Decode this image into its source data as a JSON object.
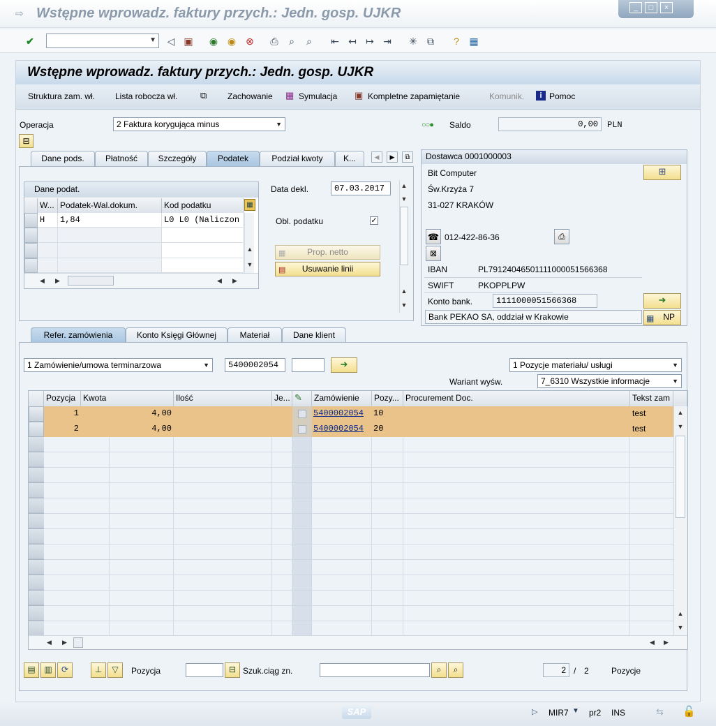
{
  "window": {
    "title": "Wstępne wprowadz. faktury przych.: Jedn. gosp. UJKR",
    "controls": [
      "minimize-icon",
      "maximize-icon",
      "close-icon"
    ]
  },
  "toolbar": {
    "command_value": "",
    "icons": [
      "enter-icon",
      "back-icon",
      "save-icon",
      "back-nav-icon",
      "exit-icon",
      "cancel-icon",
      "print-icon",
      "find-icon",
      "find-next-icon",
      "first-page-icon",
      "previous-page-icon",
      "next-page-icon",
      "last-page-icon",
      "create-session-icon",
      "shortcut-icon",
      "help-icon",
      "customize-layout-icon"
    ]
  },
  "screen": {
    "title": "Wstępne wprowadz. faktury przych.: Jedn. gosp. UJKR"
  },
  "app_toolbar": {
    "struktura": "Struktura zam. wł.",
    "lista": "Lista robocza wł.",
    "zachowanie": "Zachowanie",
    "symulacja": "Symulacja",
    "kompletne": "Kompletne zapamiętanie",
    "komunik": "Komunik.",
    "pomoc": "Pomoc"
  },
  "header": {
    "operacja_label": "Operacja",
    "operacja_value": "2 Faktura korygująca minus",
    "saldo_label": "Saldo",
    "saldo_value": "0,00",
    "currency": "PLN"
  },
  "tabs_top": [
    "Dane pods.",
    "Płatność",
    "Szczegóły",
    "Podatek",
    "Podział kwoty",
    "K..."
  ],
  "tax": {
    "group_label": "Dane podat.",
    "columns": [
      "W...",
      "Podatek-Wal.dokum.",
      "Kod podatku"
    ],
    "rows": [
      {
        "w": "H",
        "amount": "1,84",
        "code": "L0 L0 (Naliczon"
      }
    ],
    "data_dekl_label": "Data dekl.",
    "data_dekl_value": "07.03.2017",
    "obl_label": "Obl. podatku",
    "prop_netto": "Prop. netto",
    "usuwanie": "Usuwanie linii"
  },
  "vendor": {
    "title": "Dostawca 0001000003",
    "name": "Bit Computer",
    "street": "Św.Krzyża 7",
    "city": "31-027 KRAKÓW",
    "phone": "012-422-86-36",
    "iban_label": "IBAN",
    "iban": "PL79124046501111000051566368",
    "swift_label": "SWIFT",
    "swift": "PKOPPLPW",
    "konto_label": "Konto bank.",
    "konto": "1111000051566368",
    "bank": "Bank PEKAO SA, oddział w Krakowie",
    "np": "NP"
  },
  "tabs_bottom": [
    "Refer. zamówienia",
    "Konto Księgi Głównej",
    "Materiał",
    "Dane klient"
  ],
  "ref": {
    "ref_type": "1 Zamówienie/umowa terminarzowa",
    "po_number": "5400002054",
    "po_item": "",
    "layout": "1 Pozycje materiału/ usługi",
    "variant_label": "Wariant wyśw.",
    "variant": "7_6310 Wszystkie informacje"
  },
  "items": {
    "columns": [
      "Pozycja",
      "Kwota",
      "Ilość",
      "Je...",
      "",
      "Zamówienie",
      "Pozy...",
      "Procurement Doc.",
      "Tekst zam"
    ],
    "rows": [
      {
        "pos": "1",
        "kwota": "4,00",
        "ilosc": "",
        "je": "",
        "zam": "5400002054",
        "pozy": "10",
        "proc": "",
        "tekst": "test"
      },
      {
        "pos": "2",
        "kwota": "4,00",
        "ilosc": "",
        "je": "",
        "zam": "5400002054",
        "pozy": "20",
        "proc": "",
        "tekst": "test"
      }
    ]
  },
  "bottom": {
    "pozycja_label": "Pozycja",
    "pozycja_value": "",
    "szuk_label": "Szuk.ciąg zn.",
    "szuk_value": "",
    "page_current": "2",
    "page_sep": "/",
    "page_total": "2",
    "pozycje_label": "Pozycje"
  },
  "status": {
    "transaction": "MIR7",
    "server": "pr2",
    "mode": "INS",
    "logo": "SAP"
  }
}
